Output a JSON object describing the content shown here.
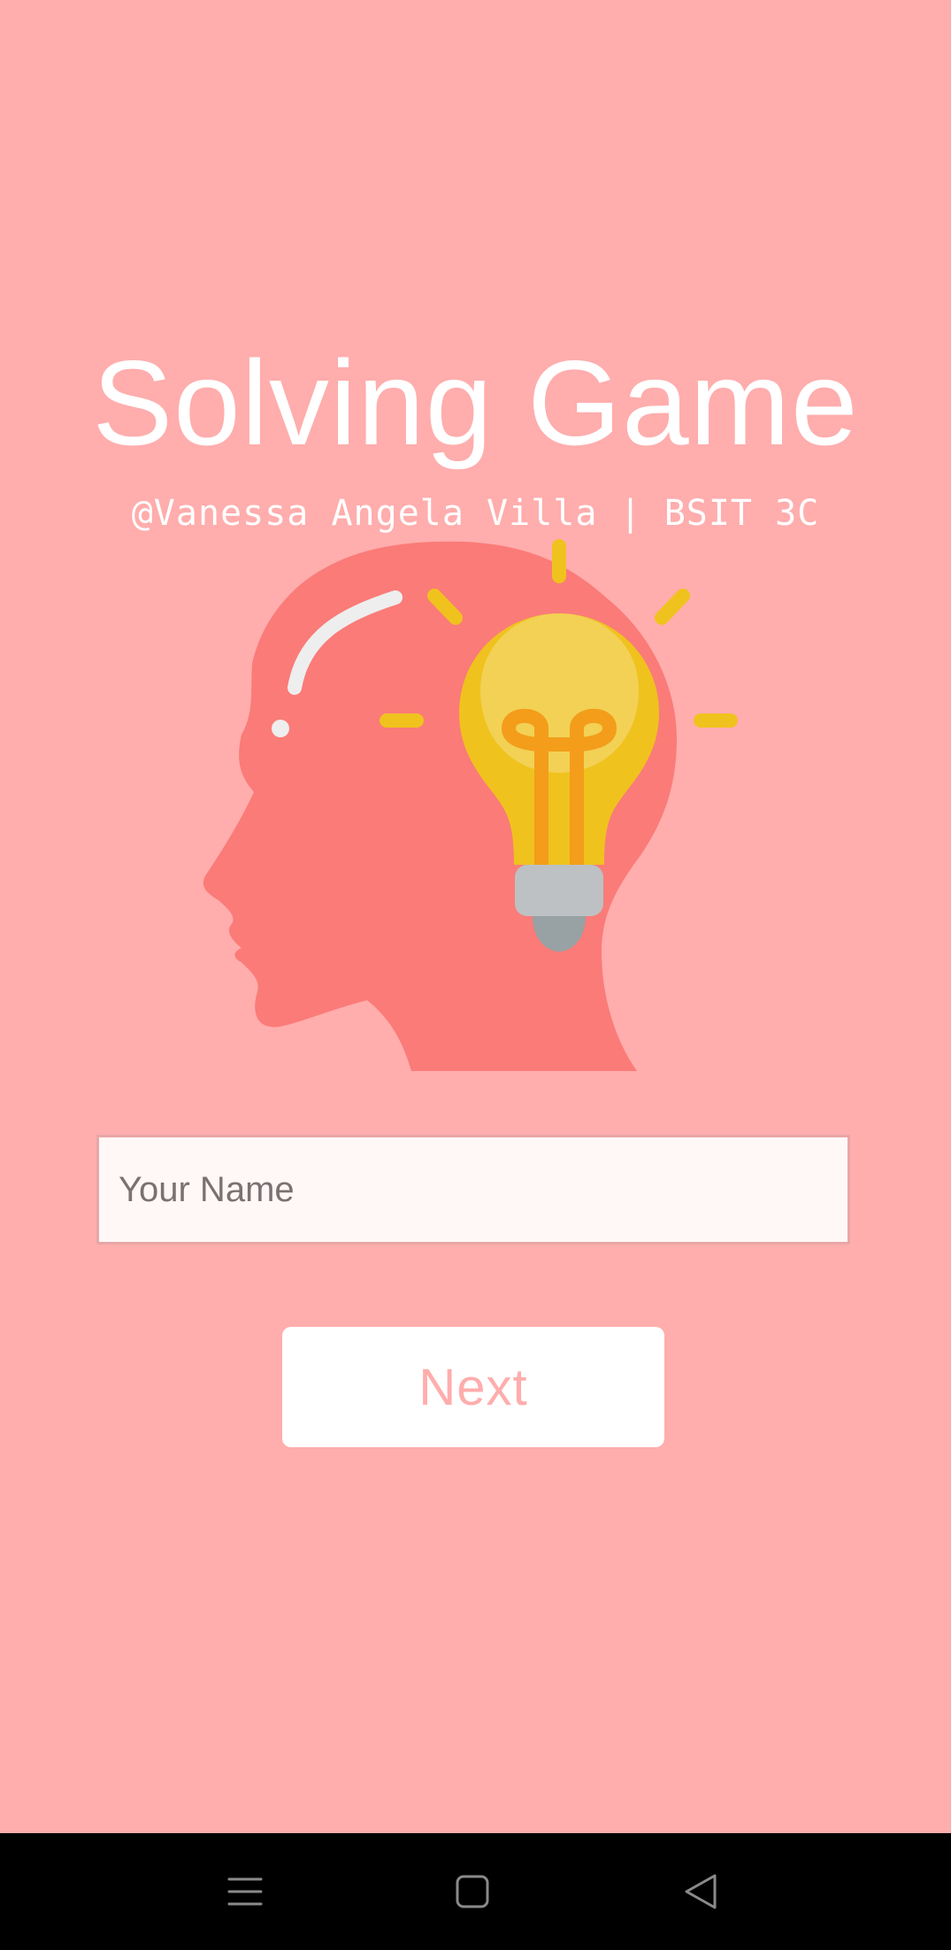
{
  "app": {
    "title": "Solving Game",
    "subtitle": "@Vanessa Angela Villa | BSIT 3C"
  },
  "illustration": {
    "icon": "head-lightbulb-icon"
  },
  "form": {
    "name_placeholder": "Your Name",
    "name_value": "",
    "next_label": "Next"
  },
  "navbar": {
    "items": [
      "menu-icon",
      "home-icon",
      "back-icon"
    ]
  },
  "colors": {
    "background": "#ffadad",
    "head": "#fa7b78",
    "bulb": "#f0c21e",
    "filament": "#f39d1b",
    "text": "#ffffff"
  }
}
